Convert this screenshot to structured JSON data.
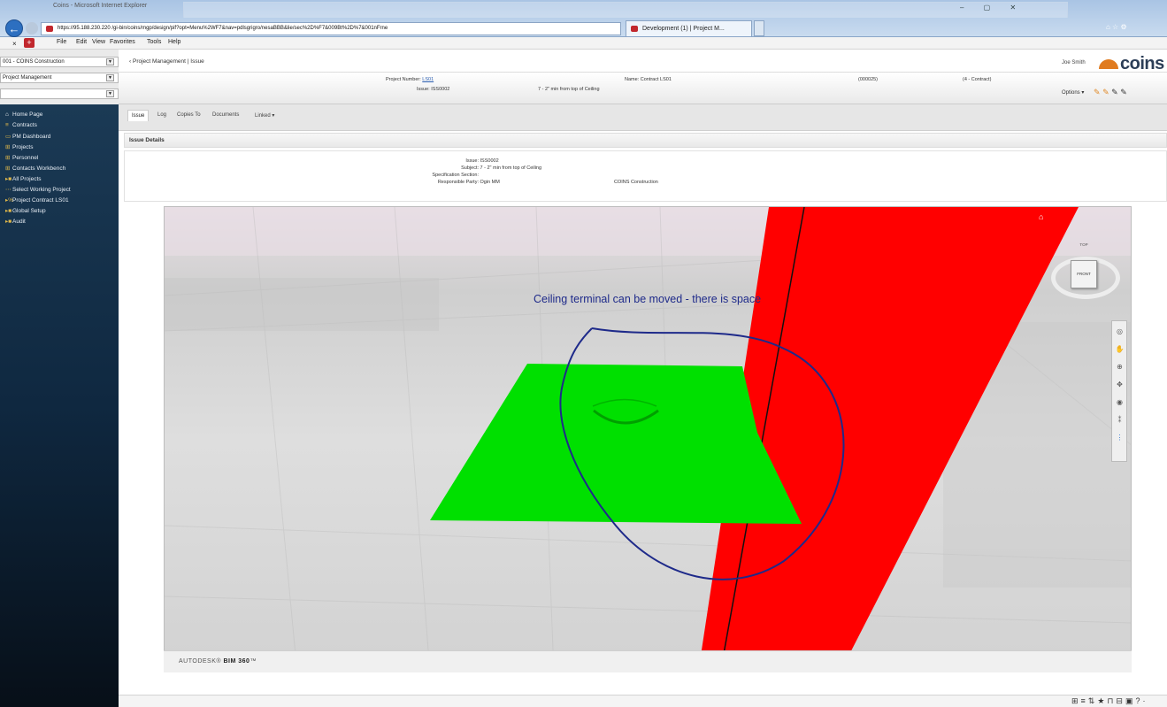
{
  "browser": {
    "window_title": "Coins - Microsoft Internet Explorer",
    "address": "https://95.188.230.220 /gi-bin/coins/mgp/design/pif?opt=Menu%2WF7&nav=pdlsgrigro/nesaBBB&lie/sec%2D%F7&009Bt%2D%7&001nFrne",
    "tab_label": "Development (1) | Project M...",
    "menu": [
      "File",
      "Edit",
      "View",
      "Favorites",
      "Tools",
      "Help"
    ]
  },
  "sidebar": {
    "company_select": "001 - COINS Construction",
    "module_select": "Project Management",
    "blank_select": "",
    "items": [
      {
        "label": "Home Page",
        "icon": "home-icon"
      },
      {
        "label": "Contracts",
        "icon": "list-icon"
      },
      {
        "label": "PM Dashboard",
        "icon": "monitor-icon"
      },
      {
        "label": "Projects",
        "icon": "projects-icon"
      },
      {
        "label": "Personnel",
        "icon": "people-icon"
      },
      {
        "label": "Contacts Workbench",
        "icon": "contacts-icon"
      },
      {
        "label": "All Projects",
        "icon": "folder-icon"
      },
      {
        "label": "Select Working Project",
        "icon": "select-icon"
      },
      {
        "label": "Project Contract LS01",
        "icon": "project-icon"
      },
      {
        "label": "Global Setup",
        "icon": "folder-icon"
      },
      {
        "label": "Audit",
        "icon": "folder-icon"
      }
    ]
  },
  "header": {
    "breadcrumb": "Project Management | Issue",
    "user": "Joe Smith",
    "brand": "coins",
    "project_number_label": "Project Number:",
    "project_number": "LS01",
    "name_label": "Name:",
    "name_value": "Contract LS01",
    "code": "(000025)",
    "contract_type": "(4 - Contract)",
    "issue_label": "Issue:",
    "issue_value": "ISS0002",
    "issue_subject": "7 - 2\" min from top of Ceiling",
    "options_label": "Options"
  },
  "tabs": [
    "Issue",
    "Log",
    "Copies To",
    "Documents",
    "Linked"
  ],
  "section": {
    "title": "Issue Details",
    "fields": [
      {
        "label": "Issue:",
        "value": "ISS0002"
      },
      {
        "label": "Subject:",
        "value": "7 - 2\" min from top of Ceiling"
      },
      {
        "label": "Specification Section:",
        "value": ""
      },
      {
        "label": "Responsible Party:",
        "value": "Ogin MM"
      }
    ],
    "company": "COINS Construction"
  },
  "viewer": {
    "markup_text": "Ceiling terminal can be moved - there is space",
    "brand_prefix": "AUTODESK",
    "brand_product": "BIM 360",
    "cube_top": "TOP",
    "cube_front": "FRONT",
    "colors": {
      "clash_red": "#ff0000",
      "terminal_green": "#00e000",
      "markup_blue": "#1e2a8a"
    }
  }
}
